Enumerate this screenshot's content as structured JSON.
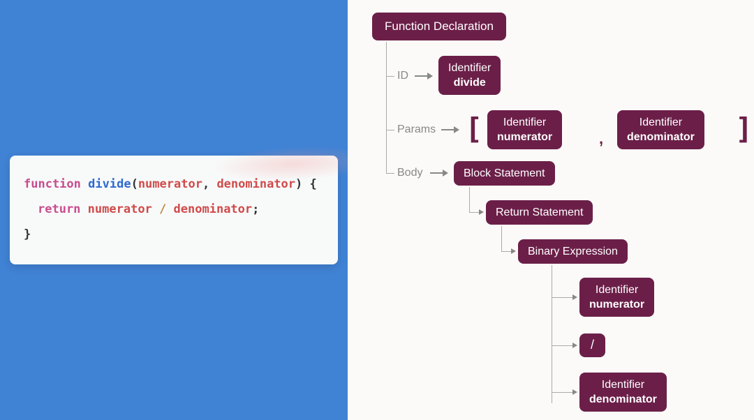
{
  "code": {
    "keyword_function": "function",
    "function_name": "divide",
    "param1": "numerator",
    "param2": "denominator",
    "keyword_return": "return",
    "operator": "/",
    "semicolon": ";",
    "open_paren": "(",
    "close_paren": ")",
    "open_brace": "{",
    "close_brace": "}",
    "comma": ","
  },
  "tree": {
    "root": "Function Declaration",
    "labels": {
      "id": "ID",
      "params": "Params",
      "body": "Body"
    },
    "id_node": {
      "title": "Identifier",
      "value": "divide"
    },
    "params": {
      "open": "[",
      "close": "]",
      "comma": ",",
      "items": [
        {
          "title": "Identifier",
          "value": "numerator"
        },
        {
          "title": "Identifier",
          "value": "denominator"
        }
      ]
    },
    "body": {
      "block": "Block Statement",
      "return": "Return Statement",
      "binary": "Binary Expression",
      "operands": [
        {
          "title": "Identifier",
          "value": "numerator"
        },
        {
          "title": "Identifier",
          "value": "denominator"
        }
      ],
      "operator": "/"
    }
  }
}
